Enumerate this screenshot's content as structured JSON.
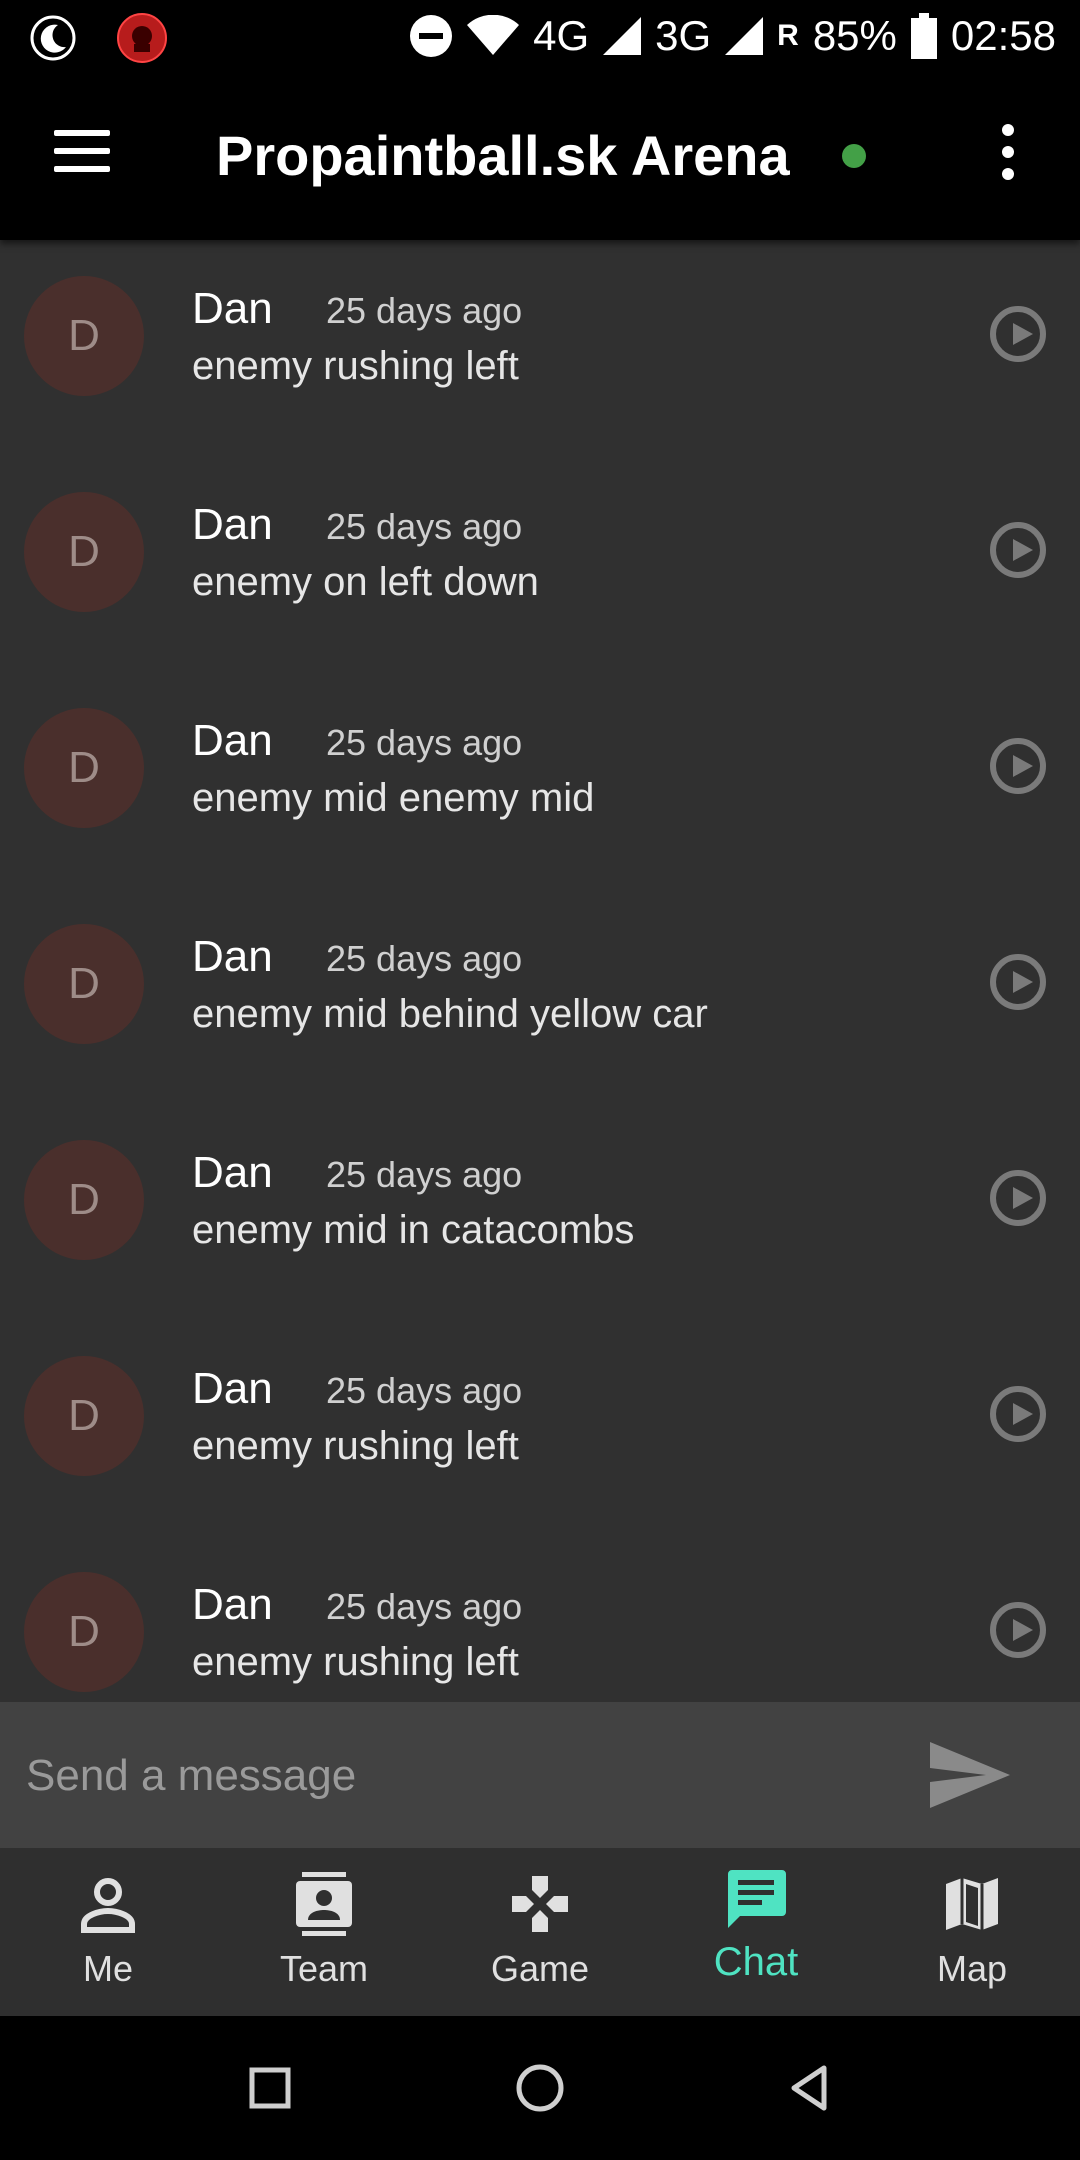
{
  "status_bar": {
    "network_4g": "4G",
    "network_3g": "3G",
    "roaming": "R",
    "battery": "85%",
    "time": "02:58"
  },
  "app_bar": {
    "title": "Propaintball.sk Arena",
    "online_color": "#43a047"
  },
  "messages": [
    {
      "initial": "D",
      "sender": "Dan",
      "time": "25 days ago",
      "text": "enemy rushing left"
    },
    {
      "initial": "D",
      "sender": "Dan",
      "time": "25 days ago",
      "text": "enemy on left down"
    },
    {
      "initial": "D",
      "sender": "Dan",
      "time": "25 days ago",
      "text": "enemy mid enemy mid"
    },
    {
      "initial": "D",
      "sender": "Dan",
      "time": "25 days ago",
      "text": "enemy mid behind yellow car"
    },
    {
      "initial": "D",
      "sender": "Dan",
      "time": "25 days ago",
      "text": "enemy mid in catacombs"
    },
    {
      "initial": "D",
      "sender": "Dan",
      "time": "25 days ago",
      "text": "enemy rushing left"
    },
    {
      "initial": "D",
      "sender": "Dan",
      "time": "25 days ago",
      "text": "enemy rushing left"
    }
  ],
  "composer": {
    "placeholder": "Send a message"
  },
  "bottom_nav": {
    "items": [
      {
        "label": "Me",
        "icon": "person-icon"
      },
      {
        "label": "Team",
        "icon": "contact-card-icon"
      },
      {
        "label": "Game",
        "icon": "gamepad-icon"
      },
      {
        "label": "Chat",
        "icon": "chat-icon",
        "active": true
      },
      {
        "label": "Map",
        "icon": "map-icon"
      }
    ],
    "active_color": "#4fe3c2"
  }
}
